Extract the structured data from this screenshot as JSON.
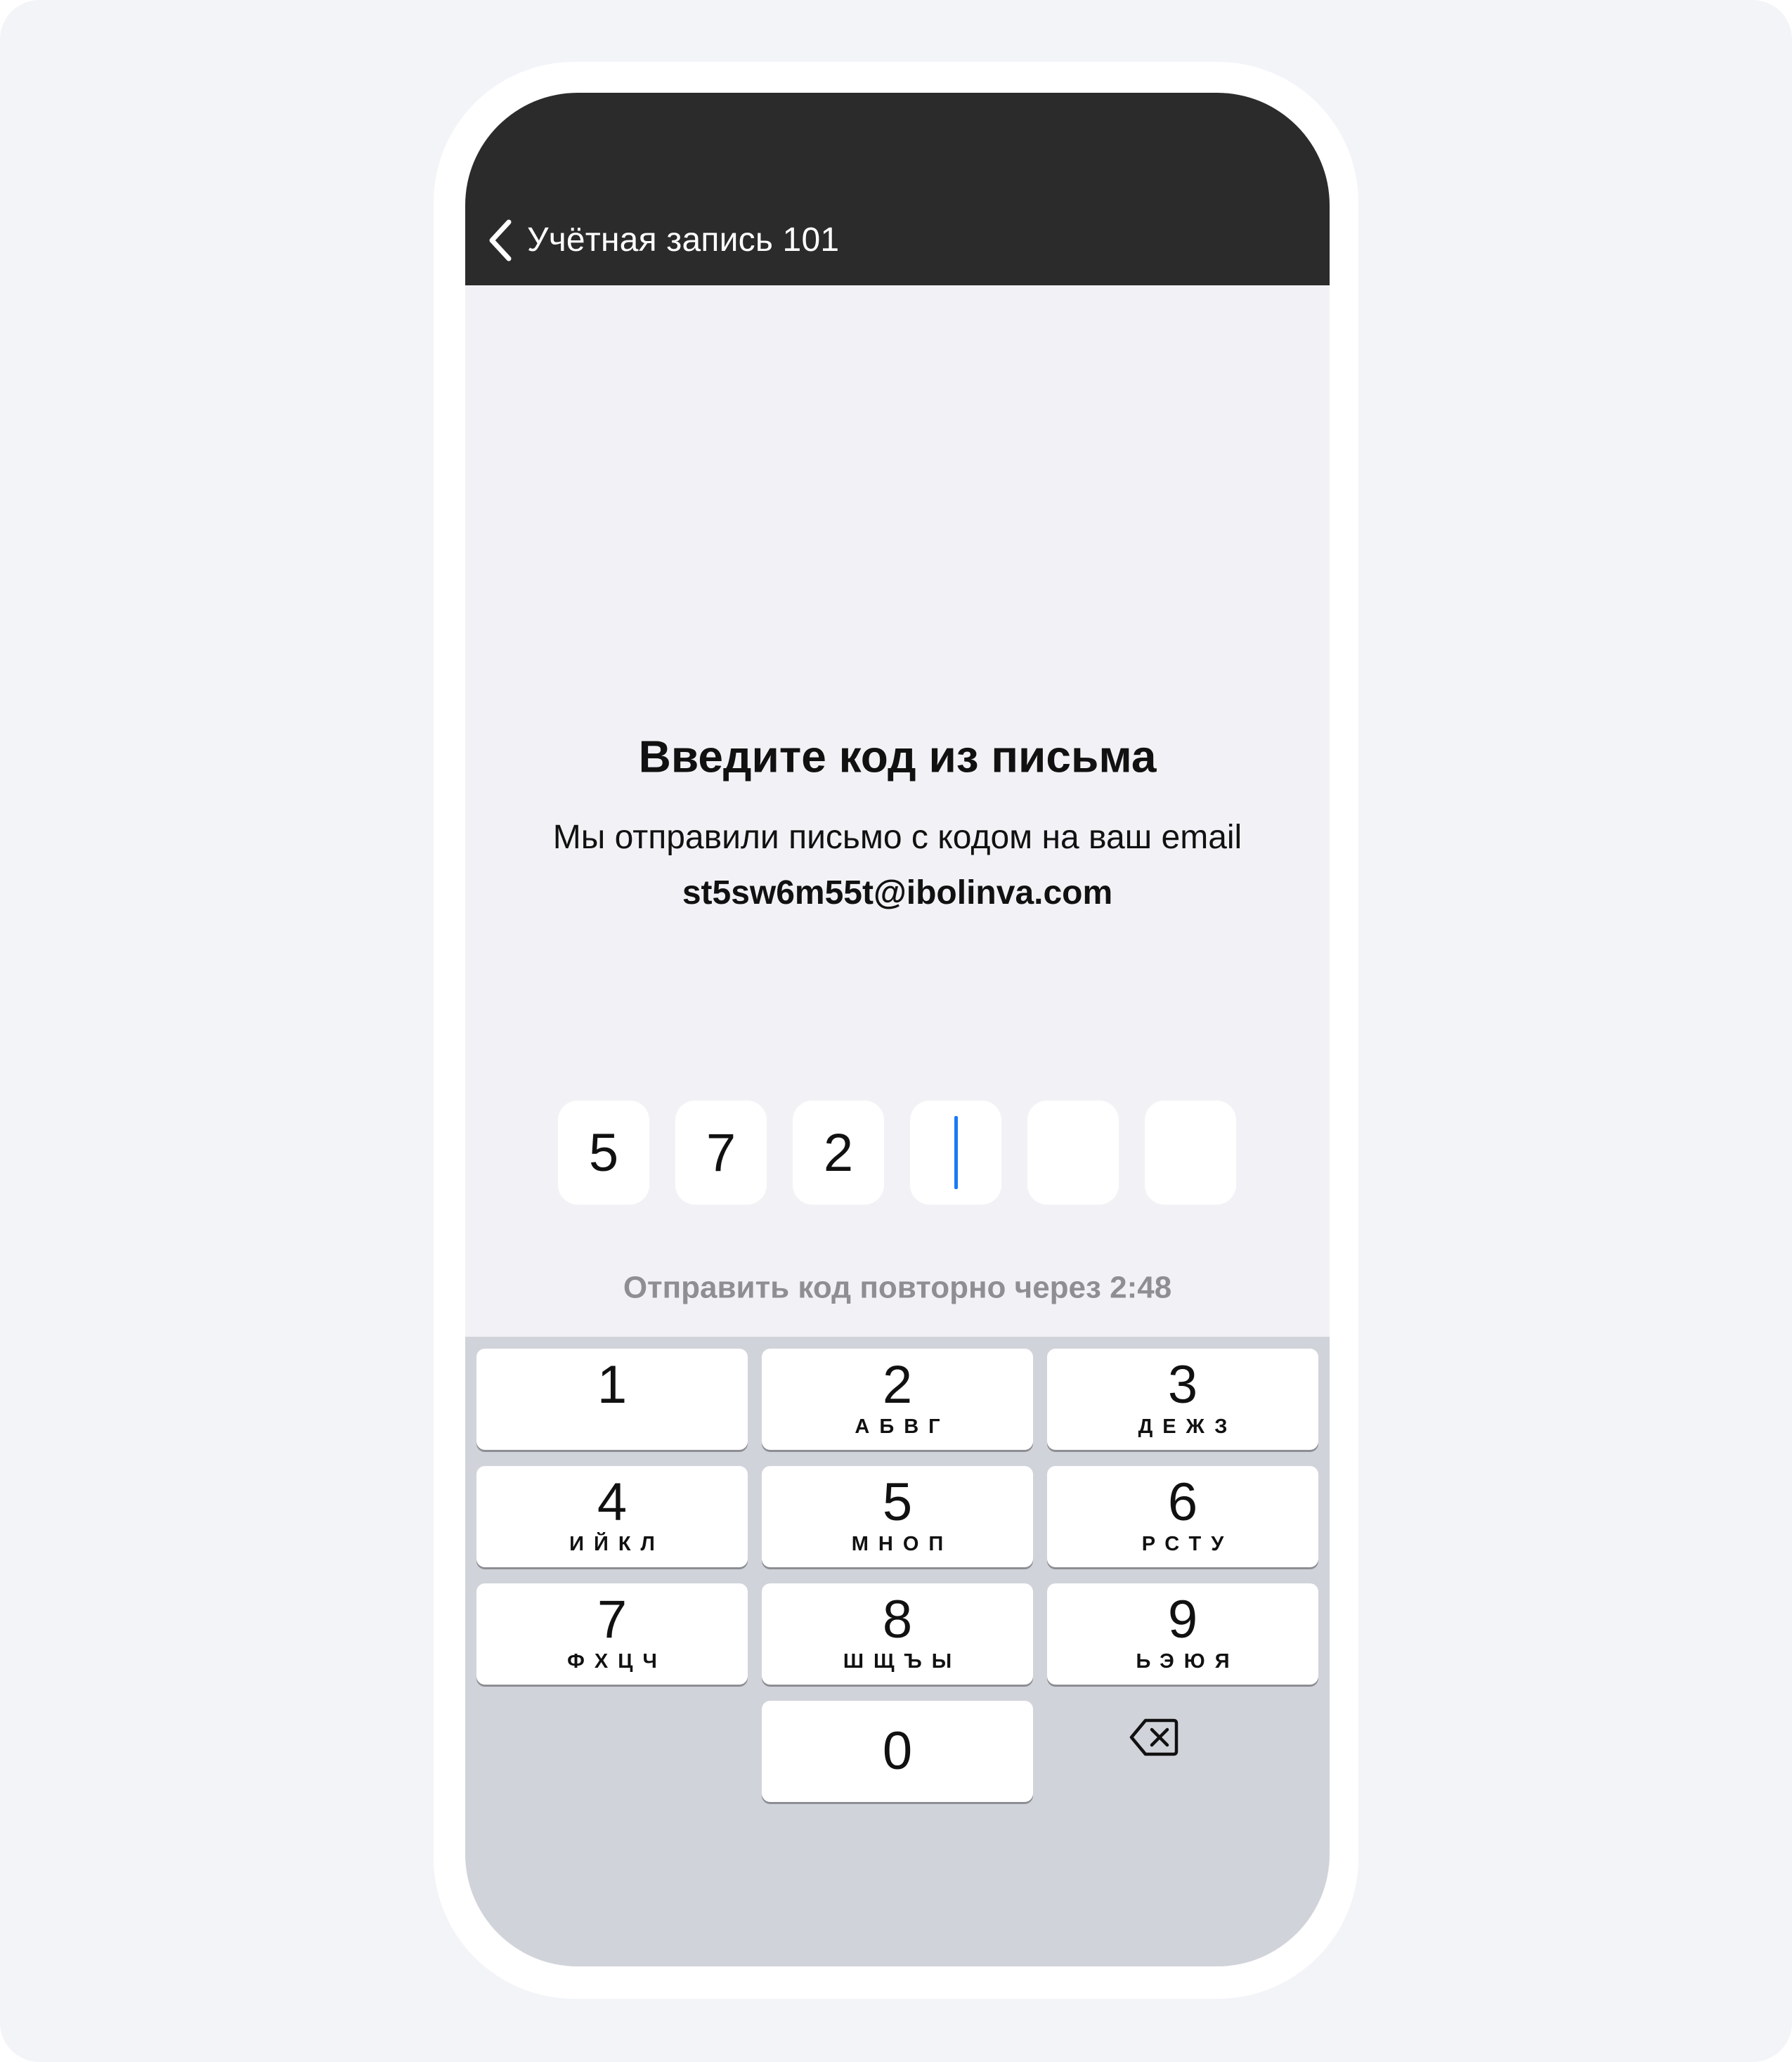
{
  "nav": {
    "back_label": "Учётная запись 101",
    "back_icon": "chevron-left-icon"
  },
  "verification": {
    "title": "Введите код из письма",
    "subtitle": "Мы отправили письмо с кодом на ваш email",
    "email": "st5sw6m55t@ibolinva.com",
    "code_digits": [
      "5",
      "7",
      "2",
      "",
      "",
      ""
    ],
    "active_digit_index": 3,
    "resend_text": "Отправить код повторно через 2:48"
  },
  "keyboard": {
    "keys": [
      {
        "digit": "1",
        "letters": ""
      },
      {
        "digit": "2",
        "letters": "АБВГ"
      },
      {
        "digit": "3",
        "letters": "ДЕЖЗ"
      },
      {
        "digit": "4",
        "letters": "ИЙКЛ"
      },
      {
        "digit": "5",
        "letters": "МНОП"
      },
      {
        "digit": "6",
        "letters": "РСТУ"
      },
      {
        "digit": "7",
        "letters": "ФХЦЧ"
      },
      {
        "digit": "8",
        "letters": "ШЩЪЫ"
      },
      {
        "digit": "9",
        "letters": "ЬЭЮЯ"
      },
      {
        "digit": "0",
        "letters": ""
      }
    ],
    "delete_icon": "backspace-icon"
  },
  "colors": {
    "navbar": "#2b2b2b",
    "screen_background": "#f2f2f6",
    "keyboard_background": "#d1d3da",
    "caret": "#1a7af6",
    "muted_text": "#8e8e93"
  }
}
